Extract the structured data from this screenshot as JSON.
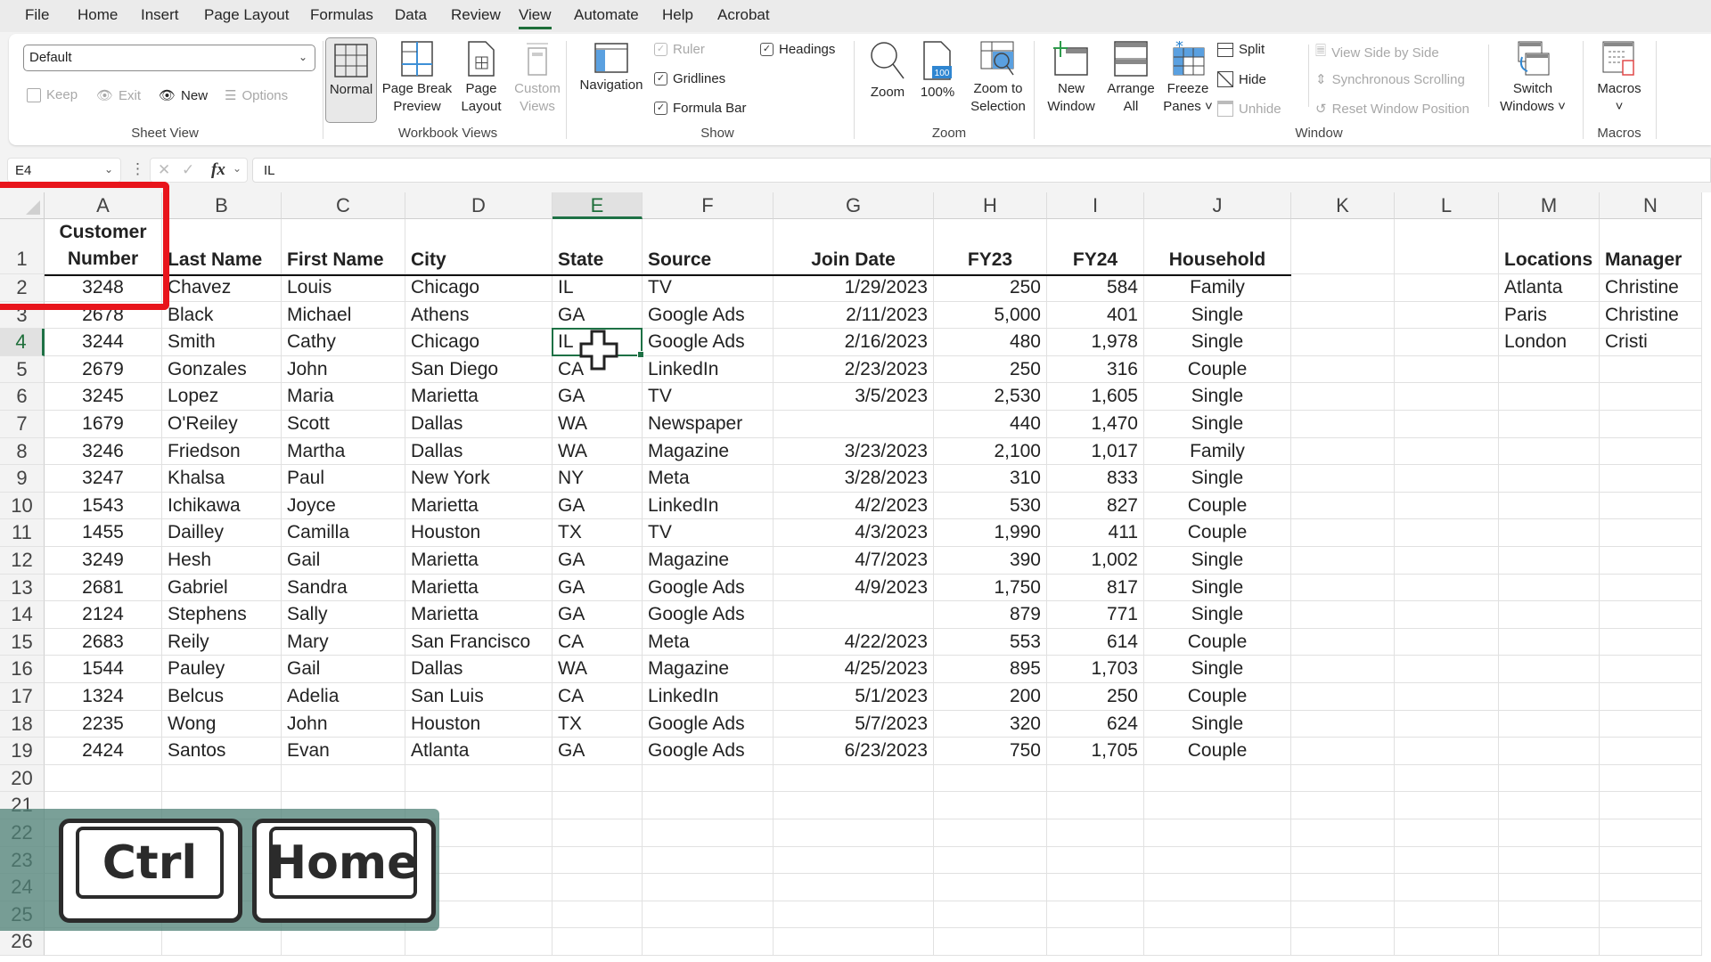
{
  "tabs": [
    {
      "label": "File",
      "active": false
    },
    {
      "label": "Home",
      "active": false
    },
    {
      "label": "Insert",
      "active": false
    },
    {
      "label": "Page Layout",
      "active": false
    },
    {
      "label": "Formulas",
      "active": false
    },
    {
      "label": "Data",
      "active": false
    },
    {
      "label": "Review",
      "active": false
    },
    {
      "label": "View",
      "active": true
    },
    {
      "label": "Automate",
      "active": false
    },
    {
      "label": "Help",
      "active": false
    },
    {
      "label": "Acrobat",
      "active": false
    }
  ],
  "ribbon": {
    "sheet_view": {
      "label": "Sheet View",
      "select_value": "Default",
      "keep": "Keep",
      "exit": "Exit",
      "new": "New",
      "options": "Options"
    },
    "workbook_views": {
      "label": "Workbook Views",
      "normal": "Normal",
      "page_break_1": "Page Break",
      "page_break_2": "Preview",
      "page_layout_1": "Page",
      "page_layout_2": "Layout",
      "custom_1": "Custom",
      "custom_2": "Views"
    },
    "show": {
      "label": "Show",
      "navigation": "Navigation",
      "ruler": "Ruler",
      "gridlines": "Gridlines",
      "formula_bar": "Formula Bar",
      "headings": "Headings",
      "check": "✓"
    },
    "zoom": {
      "label": "Zoom",
      "zoom": "Zoom",
      "hundred": "100%",
      "hundred_badge": "100",
      "zoom_sel_1": "Zoom to",
      "zoom_sel_2": "Selection"
    },
    "window": {
      "label": "Window",
      "new_1": "New",
      "new_2": "Window",
      "arrange_1": "Arrange",
      "arrange_2": "All",
      "freeze_1": "Freeze",
      "freeze_2": "Panes ˅",
      "split": "Split",
      "hide": "Hide",
      "unhide": "Unhide",
      "side_by_side": "View Side by Side",
      "sync_scroll": "Synchronous Scrolling",
      "reset_pos": "Reset Window Position",
      "switch_1": "Switch",
      "switch_2": "Windows ˅"
    },
    "macros": {
      "label": "Macros",
      "macros_1": "Macros",
      "macros_2": "˅"
    }
  },
  "formula_bar": {
    "name_box": "E4",
    "caret": "⌄",
    "more": "⋮",
    "cancel": "✕",
    "enter": "✓",
    "fx": "fx",
    "value": "IL"
  },
  "columns": [
    "A",
    "B",
    "C",
    "D",
    "E",
    "F",
    "G",
    "H",
    "I",
    "J",
    "K",
    "L",
    "M",
    "N"
  ],
  "row_numbers": [
    "1",
    "2",
    "3",
    "4",
    "5",
    "6",
    "7",
    "8",
    "9",
    "10",
    "11",
    "12",
    "13",
    "14",
    "15",
    "16",
    "17",
    "18",
    "19",
    "20",
    "21",
    "22",
    "23",
    "24",
    "25",
    "26"
  ],
  "table": {
    "header_a_1": "Customer",
    "header_a_2": "Number",
    "headers": [
      "Last Name",
      "First Name",
      "City",
      "State",
      "Source",
      "Join Date",
      "FY23",
      "FY24",
      "Household"
    ],
    "rows": [
      [
        "3248",
        "Chavez",
        "Louis",
        "Chicago",
        "IL",
        "TV",
        "1/29/2023",
        "250",
        "584",
        "Family"
      ],
      [
        "2678",
        "Black",
        "Michael",
        "Athens",
        "GA",
        "Google Ads",
        "2/11/2023",
        "5,000",
        "401",
        "Single"
      ],
      [
        "3244",
        "Smith",
        "Cathy",
        "Chicago",
        "IL",
        "Google Ads",
        "2/16/2023",
        "480",
        "1,978",
        "Single"
      ],
      [
        "2679",
        "Gonzales",
        "John",
        "San Diego",
        "CA",
        "LinkedIn",
        "2/23/2023",
        "250",
        "316",
        "Couple"
      ],
      [
        "3245",
        "Lopez",
        "Maria",
        "Marietta",
        "GA",
        "TV",
        "3/5/2023",
        "2,530",
        "1,605",
        "Single"
      ],
      [
        "1679",
        "O'Reiley",
        "Scott",
        "Dallas",
        "WA",
        "Newspaper",
        "",
        "440",
        "1,470",
        "Single"
      ],
      [
        "3246",
        "Friedson",
        "Martha",
        "Dallas",
        "WA",
        "Magazine",
        "3/23/2023",
        "2,100",
        "1,017",
        "Family"
      ],
      [
        "3247",
        "Khalsa",
        "Paul",
        "New York",
        "NY",
        "Meta",
        "3/28/2023",
        "310",
        "833",
        "Single"
      ],
      [
        "1543",
        "Ichikawa",
        "Joyce",
        "Marietta",
        "GA",
        "LinkedIn",
        "4/2/2023",
        "530",
        "827",
        "Couple"
      ],
      [
        "1455",
        "Dailley",
        "Camilla",
        "Houston",
        "TX",
        "TV",
        "4/3/2023",
        "1,990",
        "411",
        "Couple"
      ],
      [
        "3249",
        "Hesh",
        "Gail",
        "Marietta",
        "GA",
        "Magazine",
        "4/7/2023",
        "390",
        "1,002",
        "Single"
      ],
      [
        "2681",
        "Gabriel",
        "Sandra",
        "Marietta",
        "GA",
        "Google Ads",
        "4/9/2023",
        "1,750",
        "817",
        "Single"
      ],
      [
        "2124",
        "Stephens",
        "Sally",
        "Marietta",
        "GA",
        "Google Ads",
        "",
        "879",
        "771",
        "Single"
      ],
      [
        "2683",
        "Reily",
        "Mary",
        "San Francisco",
        "CA",
        "Meta",
        "4/22/2023",
        "553",
        "614",
        "Couple"
      ],
      [
        "1544",
        "Pauley",
        "Gail",
        "Dallas",
        "WA",
        "Magazine",
        "4/25/2023",
        "895",
        "1,703",
        "Single"
      ],
      [
        "1324",
        "Belcus",
        "Adelia",
        "San Luis",
        "CA",
        "LinkedIn",
        "5/1/2023",
        "200",
        "250",
        "Couple"
      ],
      [
        "2235",
        "Wong",
        "John",
        "Houston",
        "TX",
        "Google Ads",
        "5/7/2023",
        "320",
        "624",
        "Single"
      ],
      [
        "2424",
        "Santos",
        "Evan",
        "Atlanta",
        "GA",
        "Google Ads",
        "6/23/2023",
        "750",
        "1,705",
        "Couple"
      ]
    ]
  },
  "side_table": {
    "headers": [
      "Locations",
      "Manager"
    ],
    "rows": [
      [
        "Atlanta",
        "Christine"
      ],
      [
        "Paris",
        "Christine"
      ],
      [
        "London",
        "Cristi"
      ]
    ]
  },
  "active_cell": "E4",
  "keys": [
    "Ctrl",
    "Home"
  ],
  "colors": {
    "accent_green": "#1e7145",
    "highlight_red": "#e8141b",
    "overlay_teal": "#4e8076"
  }
}
